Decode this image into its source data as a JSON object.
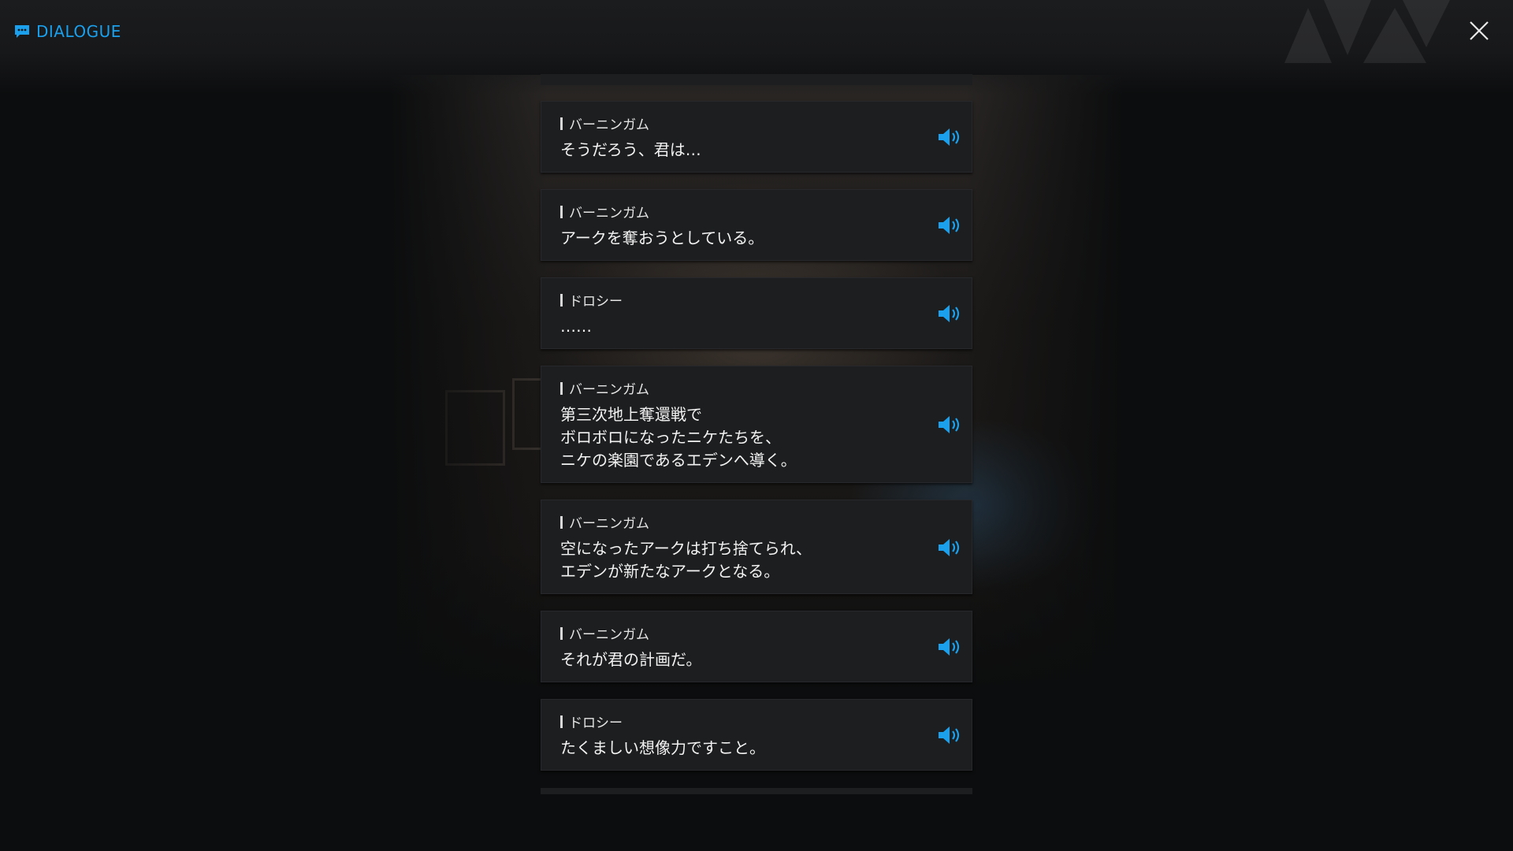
{
  "header": {
    "title": "DIALOGUE",
    "icon": "chat-icon",
    "accent_color": "#1aa0ec"
  },
  "close": {
    "icon": "close-icon"
  },
  "dialogue": [
    {
      "speaker": "バーニンガム",
      "text": "そうだろう、君は…"
    },
    {
      "speaker": "バーニンガム",
      "text": "アークを奪おうとしている。"
    },
    {
      "speaker": "ドロシー",
      "text": "……"
    },
    {
      "speaker": "バーニンガム",
      "text": "第三次地上奪還戦で\nボロボロになったニケたちを、\nニケの楽園であるエデンへ導く。"
    },
    {
      "speaker": "バーニンガム",
      "text": "空になったアークは打ち捨てられ、\nエデンが新たなアークとなる。"
    },
    {
      "speaker": "バーニンガム",
      "text": "それが君の計画だ。"
    },
    {
      "speaker": "ドロシー",
      "text": "たくましい想像力ですこと。"
    }
  ],
  "voice_icon": "speaker-icon"
}
